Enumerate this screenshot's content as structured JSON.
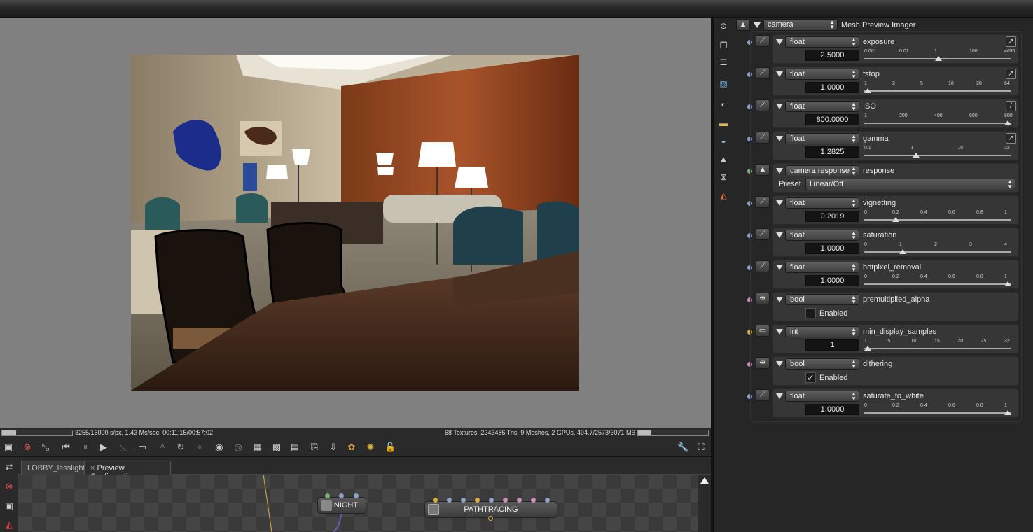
{
  "viewport": {
    "status_left": "3255/16000 s/px, 1.43 Ms/sec, 00:11:15/00:57:02",
    "status_right": "68 Textures, 2243486 Tris, 9 Meshes, 2 GPUs, 494.7/2573/3071 MB",
    "render_progress": 0.2,
    "memory_progress": 0.19
  },
  "graph": {
    "tabs": [
      "LOBBY_lesslight",
      "Preview Configuration"
    ],
    "tab_close": "×",
    "nodes": {
      "night": "NIGHT",
      "pathtracing": "PATHTRACING"
    }
  },
  "panel": {
    "header": {
      "kind": "camera",
      "title": "Mesh Preview Imager"
    },
    "params": [
      {
        "type": "float",
        "name": "exposure",
        "value": "2.5000",
        "ticks": [
          "0.001",
          "0.01",
          "1",
          "100",
          "4096"
        ],
        "dot": "#8fa0c8",
        "curve": "↗"
      },
      {
        "type": "float",
        "name": "fstop",
        "value": "1.0000",
        "ticks": [
          "1",
          "2",
          "5",
          "10",
          "20",
          "64"
        ],
        "dot": "#8fa0c8",
        "curve": "↗"
      },
      {
        "type": "float",
        "name": "ISO",
        "value": "800.0000",
        "ticks": [
          "1",
          "200",
          "400",
          "600",
          "800"
        ],
        "dot": "#8fa0c8",
        "curve": "/"
      },
      {
        "type": "float",
        "name": "gamma",
        "value": "1.2825",
        "ticks": [
          "0.1",
          "1",
          "10",
          "32"
        ],
        "dot": "#8fa0c8",
        "curve": "↗"
      },
      {
        "type": "camera response",
        "name": "response",
        "preset_label": "Preset",
        "preset_value": "Linear/Off",
        "dot": "#7fb07f"
      },
      {
        "type": "float",
        "name": "vignetting",
        "value": "0.2019",
        "ticks": [
          "0",
          "0.2",
          "0.4",
          "0.6",
          "0.8",
          "1"
        ],
        "dot": "#8fa0c8"
      },
      {
        "type": "float",
        "name": "saturation",
        "value": "1.0000",
        "ticks": [
          "0",
          "1",
          "2",
          "3",
          "4"
        ],
        "dot": "#8fa0c8"
      },
      {
        "type": "float",
        "name": "hotpixel_removal",
        "value": "1.0000",
        "ticks": [
          "0",
          "0.2",
          "0.4",
          "0.6",
          "0.8",
          "1"
        ],
        "dot": "#8fa0c8"
      },
      {
        "type": "bool",
        "name": "premultiplied_alpha",
        "checkbox_label": "Enabled",
        "checked": false,
        "dot": "#c890b8"
      },
      {
        "type": "int",
        "name": "min_display_samples",
        "value": "1",
        "ticks": [
          "1",
          "5",
          "10",
          "15",
          "20",
          "25",
          "32"
        ],
        "dot": "#d8b040"
      },
      {
        "type": "bool",
        "name": "dithering",
        "checkbox_label": "Enabled",
        "checked": true,
        "dot": "#c890b8"
      },
      {
        "type": "float",
        "name": "saturate_to_white",
        "value": "1.0000",
        "ticks": [
          "0",
          "0.2",
          "0.4",
          "0.6",
          "0.8",
          "1"
        ],
        "dot": "#8fa0c8"
      }
    ]
  }
}
